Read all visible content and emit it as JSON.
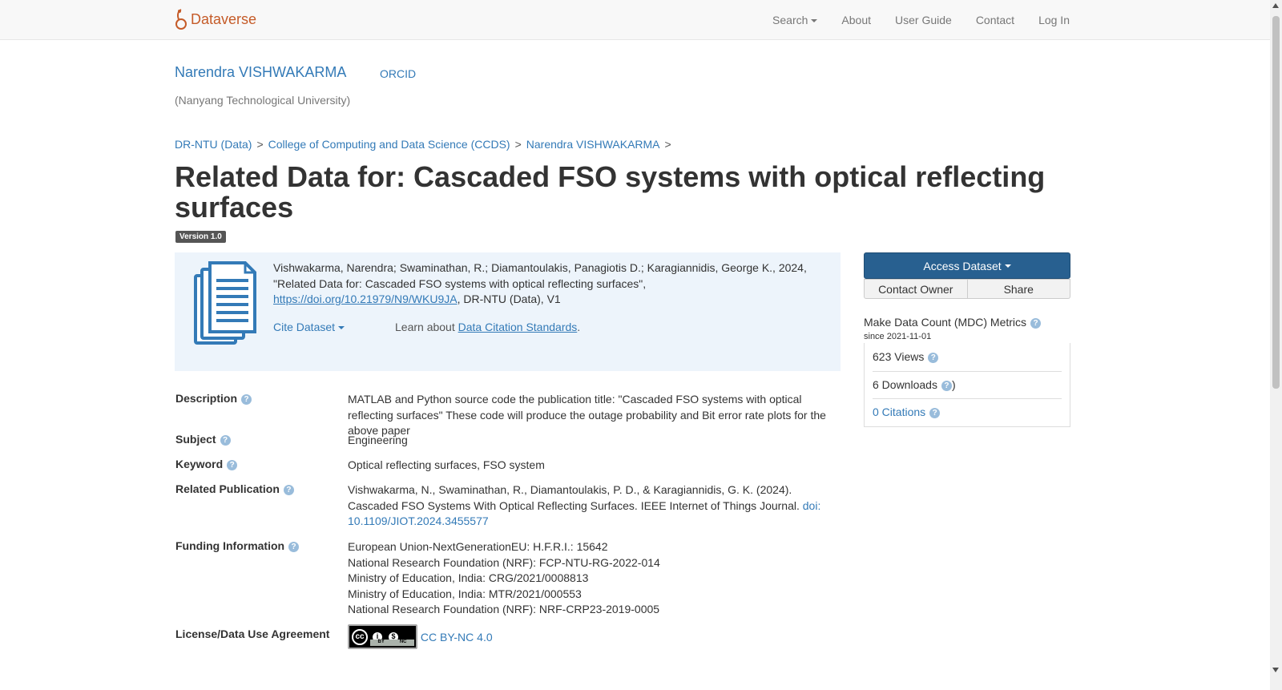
{
  "navbar": {
    "brand": "Dataverse",
    "search": "Search",
    "about": "About",
    "user_guide": "User Guide",
    "contact": "Contact",
    "login": "Log In"
  },
  "dataverse": {
    "name": "Narendra VISHWAKARMA",
    "orcid": "ORCID",
    "affiliation": "(Nanyang Technological University)"
  },
  "breadcrumb": [
    "DR-NTU (Data)",
    "College of Computing and Data Science (CCDS)",
    "Narendra VISHWAKARMA"
  ],
  "breadcrumb_sep": ">",
  "dataset": {
    "title": "Related Data for: Cascaded FSO systems with optical reflecting surfaces",
    "version": "Version 1.0"
  },
  "citation": {
    "text_before": "Vishwakarma, Narendra; Swaminathan, R.; Diamantoulakis, Panagiotis D.; Karagiannidis, George K., 2024, \"Related Data for: Cascaded FSO systems with optical reflecting surfaces\", ",
    "doi": "https://doi.org/10.21979/N9/WKU9JA",
    "text_after": ", DR-NTU (Data), V1",
    "cite_label": "Cite Dataset",
    "learn_prefix": "Learn about ",
    "learn_link": "Data Citation Standards",
    "learn_suffix": "."
  },
  "metadata": {
    "description_label": "Description",
    "description": "MATLAB and Python source code the publication title: \"Cascaded FSO systems with optical reflecting surfaces\" These code will produce the outage probability and Bit error rate plots for the above paper",
    "subject_label": "Subject",
    "subject": "Engineering",
    "keyword_label": "Keyword",
    "keyword": "Optical reflecting surfaces, FSO system",
    "related_pub_label": "Related Publication",
    "related_pub": "Vishwakarma, N., Swaminathan, R., Diamantoulakis, P. D., & Karagiannidis, G. K. (2024). Cascaded FSO Systems With Optical Reflecting Surfaces. IEEE Internet of Things Journal. ",
    "related_pub_link": "doi: 10.1109/JIOT.2024.3455577",
    "funding_label": "Funding Information",
    "funding": [
      "European Union-NextGenerationEU: H.F.R.I.: 15642",
      "National Research Foundation (NRF): FCP-NTU-RG-2022-014",
      "Ministry of Education, India: CRG/2021/0008813",
      "Ministry of Education, India: MTR/2021/000553",
      "National Research Foundation (NRF): NRF-CRP23-2019-0005"
    ],
    "license_label": "License/Data Use Agreement",
    "license": "CC BY-NC 4.0",
    "license_badge_by": "BY",
    "license_badge_nc": "NC"
  },
  "sidebar": {
    "access": "Access Dataset",
    "contact_owner": "Contact Owner",
    "share": "Share",
    "mdc_title": "Make Data Count (MDC) Metrics",
    "mdc_since": "since 2021-11-01",
    "views": "623 Views",
    "downloads": "6 Downloads",
    "downloads_close": ")",
    "citations": "0 Citations"
  },
  "colors": {
    "brand": "#c55b28",
    "link": "#337ab7",
    "primary_button": "#286090",
    "citation_bg": "#edf4fb"
  }
}
